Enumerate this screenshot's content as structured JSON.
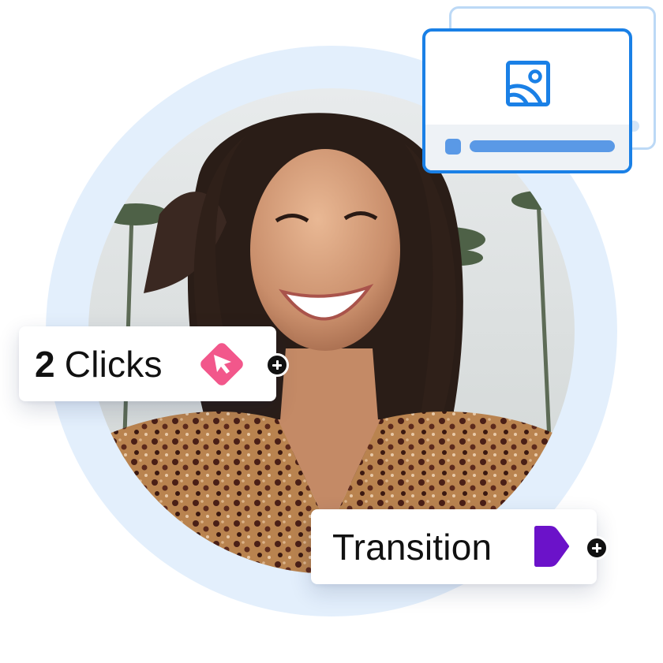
{
  "hero": {
    "photo": "smiling-woman-photo"
  },
  "clicks_chip": {
    "count": "2",
    "label": "Clicks",
    "icon": "cursor-diamond-icon",
    "icon_color": "#f2578b",
    "add_icon": "plus-circle-icon"
  },
  "transition_chip": {
    "label": "Transition",
    "icon": "play-arrow-icon",
    "icon_color": "#6b12c9",
    "add_icon": "plus-circle-icon"
  },
  "image_card": {
    "icon": "image-icon",
    "accent": "#1a80e6"
  },
  "colors": {
    "ring": "#e3effc",
    "card_border": "#1a80e6"
  }
}
